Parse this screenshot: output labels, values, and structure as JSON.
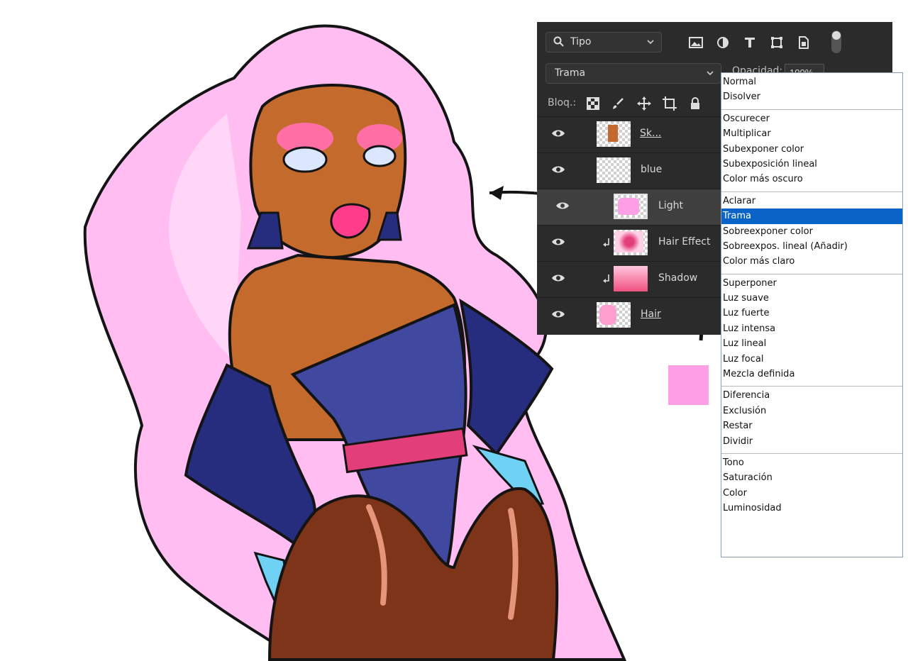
{
  "colors": {
    "hair": "#ffbdf2",
    "skin": "#c46a2c",
    "suit": "#4148a0",
    "gloves": "#262c7e",
    "belt": "#e23e79",
    "tights": "#7e3418",
    "panel_bg": "#2b2b2b",
    "menu_highlight": "#0a64c8",
    "swatch": "#ff9fe6"
  },
  "panel": {
    "filter": {
      "value": "Tipo",
      "icon": "search-icon"
    },
    "filter_icons": [
      "image-filter-icon",
      "adjustment-filter-icon",
      "type-filter-icon",
      "shape-filter-icon",
      "smart-object-filter-icon"
    ],
    "blend_mode": "Trama",
    "opacity_label": "Opacidad:",
    "opacity_value": "100%",
    "lock_label": "Bloq.:",
    "lock_icons": [
      "lock-transparent-icon",
      "lock-paint-icon",
      "lock-move-icon",
      "lock-artboard-icon",
      "lock-all-icon"
    ],
    "layers": [
      {
        "name": "Sk...",
        "selected": false,
        "clipped": false
      },
      {
        "name": "blue",
        "selected": false,
        "clipped": false
      },
      {
        "name": "Light",
        "selected": true,
        "clipped": false
      },
      {
        "name": "Hair Effect",
        "selected": false,
        "clipped": true
      },
      {
        "name": "Shadow",
        "selected": false,
        "clipped": true
      },
      {
        "name": "Hair",
        "selected": false,
        "clipped": false
      }
    ]
  },
  "blend_menu": {
    "groups": [
      [
        "Normal",
        "Disolver"
      ],
      [
        "Oscurecer",
        "Multiplicar",
        "Subexponer color",
        "Subexposición lineal",
        "Color más oscuro"
      ],
      [
        "Aclarar",
        "Trama",
        "Sobreexponer color",
        "Sobreexpos. lineal (Añadir)",
        "Color más claro"
      ],
      [
        "Superponer",
        "Luz suave",
        "Luz fuerte",
        "Luz intensa",
        "Luz lineal",
        "Luz focal",
        "Mezcla definida"
      ],
      [
        "Diferencia",
        "Exclusión",
        "Restar",
        "Dividir"
      ],
      [
        "Tono",
        "Saturación",
        "Color",
        "Luminosidad"
      ]
    ],
    "selected": "Trama"
  }
}
